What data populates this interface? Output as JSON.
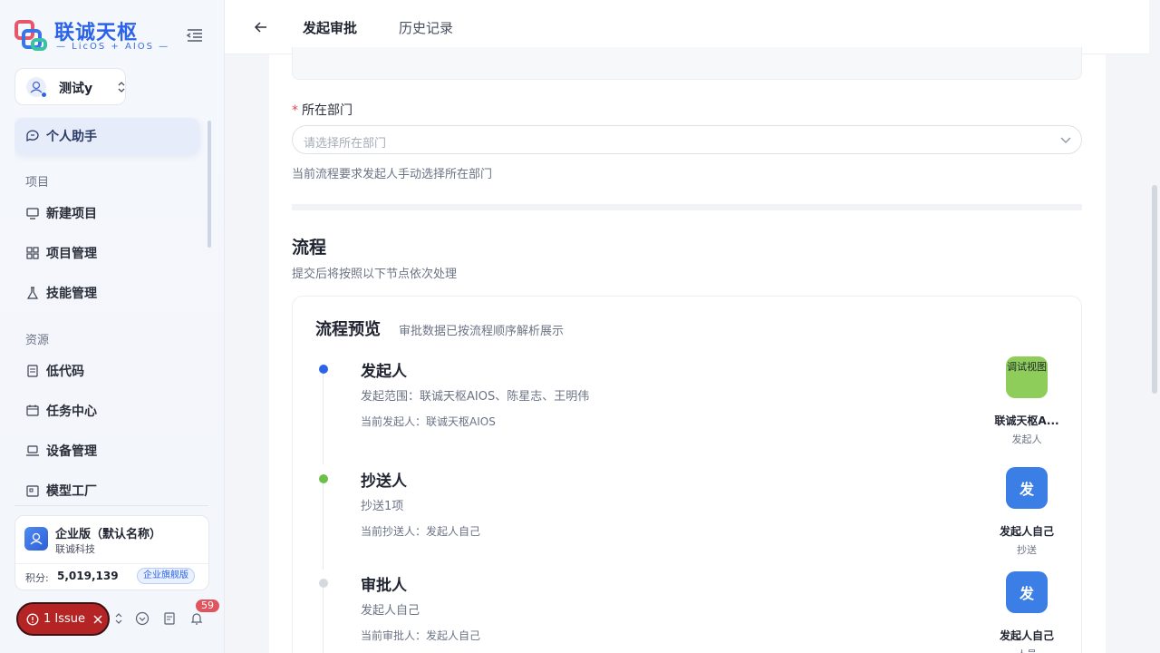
{
  "brand": {
    "title": "联诚天枢",
    "subtitle": "— LicOS + AIOS —",
    "colors": {
      "primary": "#2c63e8",
      "danger": "#b52424",
      "green": "#6cc04a"
    }
  },
  "user": {
    "name": "测试y"
  },
  "sidebar": {
    "active_item": {
      "label": "个人助手",
      "icon": "chat-icon"
    },
    "sections": [
      {
        "title": "项目",
        "items": [
          {
            "label": "新建项目",
            "icon": "monitor-icon"
          },
          {
            "label": "项目管理",
            "icon": "grid-icon"
          },
          {
            "label": "技能管理",
            "icon": "flask-icon"
          }
        ]
      },
      {
        "title": "资源",
        "items": [
          {
            "label": "低代码",
            "icon": "document-icon"
          },
          {
            "label": "任务中心",
            "icon": "calendar-icon"
          },
          {
            "label": "设备管理",
            "icon": "laptop-icon"
          },
          {
            "label": "模型工厂",
            "icon": "factory-icon"
          }
        ]
      }
    ]
  },
  "enterprise": {
    "name": "企业版（默认名称）",
    "company": "联诚科技",
    "points_label": "积分:",
    "points": "5,019,139",
    "badge": "企业旗舰版"
  },
  "footer": {
    "issue_label": "1 Issue",
    "notification_count": "59"
  },
  "topbar": {
    "tabs": [
      {
        "label": "发起审批",
        "active": true
      },
      {
        "label": "历史记录",
        "active": false
      }
    ]
  },
  "form": {
    "department": {
      "label": "所在部门",
      "required_mark": "*",
      "placeholder": "请选择所在部门",
      "hint": "当前流程要求发起人手动选择所在部门"
    }
  },
  "flow": {
    "title": "流程",
    "subtitle": "提交后将按照以下节点依次处理",
    "preview_title": "流程预览",
    "preview_desc": "审批数据已按流程顺序解析展示",
    "nodes": [
      {
        "title": "发起人",
        "desc": "发起范围：联诚天枢AIOS、陈星志、王明伟",
        "current": "当前发起人：联诚天枢AIOS",
        "dot_color": "#2c63e8",
        "person": {
          "avatar_text": "调试视图",
          "name": "联诚天枢A...",
          "role": "发起人"
        }
      },
      {
        "title": "抄送人",
        "desc": "抄送1项",
        "current": "当前抄送人：发起人自己",
        "dot_color": "#6cc04a",
        "person": {
          "avatar_text": "发",
          "name": "发起人自己",
          "role": "抄送"
        }
      },
      {
        "title": "审批人",
        "desc": "发起人自己",
        "current": "当前审批人：发起人自己",
        "dot_color": "#d6d9df",
        "person": {
          "avatar_text": "发",
          "name": "发起人自己",
          "role": "人员"
        }
      }
    ]
  }
}
